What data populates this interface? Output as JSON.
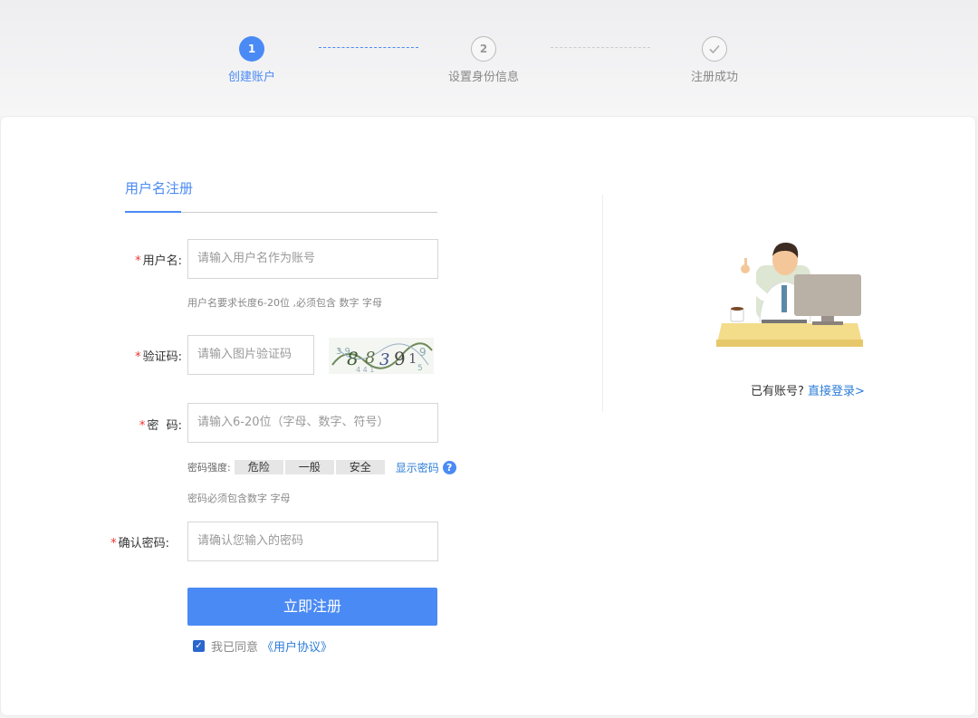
{
  "steps": [
    {
      "number": "1",
      "label": "创建账户",
      "state": "active"
    },
    {
      "number": "2",
      "label": "设置身份信息",
      "state": "pending"
    },
    {
      "number": "",
      "label": "注册成功",
      "state": "pending"
    }
  ],
  "form": {
    "tab_label": "用户名注册",
    "username": {
      "label": "用户名:",
      "placeholder": "请输入用户名作为账号",
      "hint": "用户名要求长度6-20位 ,必须包含 数字 字母"
    },
    "captcha": {
      "label": "验证码:",
      "placeholder": "请输入图片验证码"
    },
    "password": {
      "label": "密  码:",
      "placeholder": "请输入6-20位（字母、数字、符号）",
      "hint": "密码必须包含数字 字母"
    },
    "strength": {
      "label": "密码强度:",
      "levels": [
        "危险",
        "一般",
        "安全"
      ],
      "show_password": "显示密码"
    },
    "confirm": {
      "label": "确认密码:",
      "placeholder": "请确认您输入的密码"
    },
    "required_mark": "*",
    "submit_label": "立即注册",
    "agree": {
      "text": "我已同意",
      "link": "《用户协议》",
      "checked": true
    }
  },
  "side": {
    "have_account": "已有账号?",
    "login_link": "直接登录>"
  },
  "colors": {
    "accent": "#4a8af4",
    "link": "#2b7cd8",
    "required": "#e33333"
  }
}
